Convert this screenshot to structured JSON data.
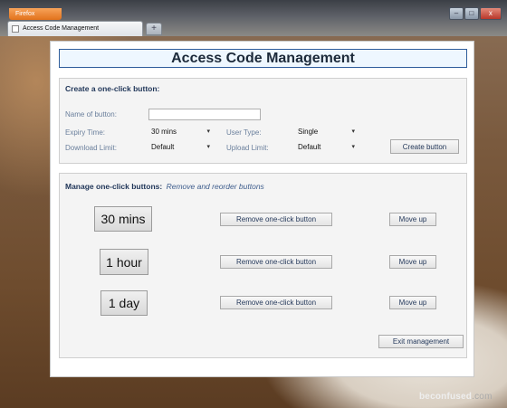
{
  "browser": {
    "menu_button": "Firefox",
    "tab_title": "Access Code Management",
    "new_tab": "+",
    "controls": [
      "–",
      "□",
      "x"
    ]
  },
  "watermark": {
    "main": "beconfused",
    "dim": ".com"
  },
  "page": {
    "title": "Access Code Management",
    "create": {
      "heading": "Create a one-click button:",
      "name_label": "Name of button:",
      "name_value": "",
      "expiry_label": "Expiry Time:",
      "expiry_value": "30 mins",
      "user_type_label": "User Type:",
      "user_type_value": "Single",
      "download_label": "Download Limit:",
      "download_value": "Default",
      "upload_label": "Upload Limit:",
      "upload_value": "Default",
      "create_button": "Create button"
    },
    "manage": {
      "heading": "Manage one-click buttons:",
      "subheading": "Remove and reorder buttons",
      "rows": [
        {
          "label": "30 mins",
          "remove": "Remove one-click button",
          "move": "Move up"
        },
        {
          "label": "1 hour",
          "remove": "Remove one-click button",
          "move": "Move up"
        },
        {
          "label": "1 day",
          "remove": "Remove one-click button",
          "move": "Move up"
        }
      ],
      "exit_button": "Exit management"
    }
  }
}
